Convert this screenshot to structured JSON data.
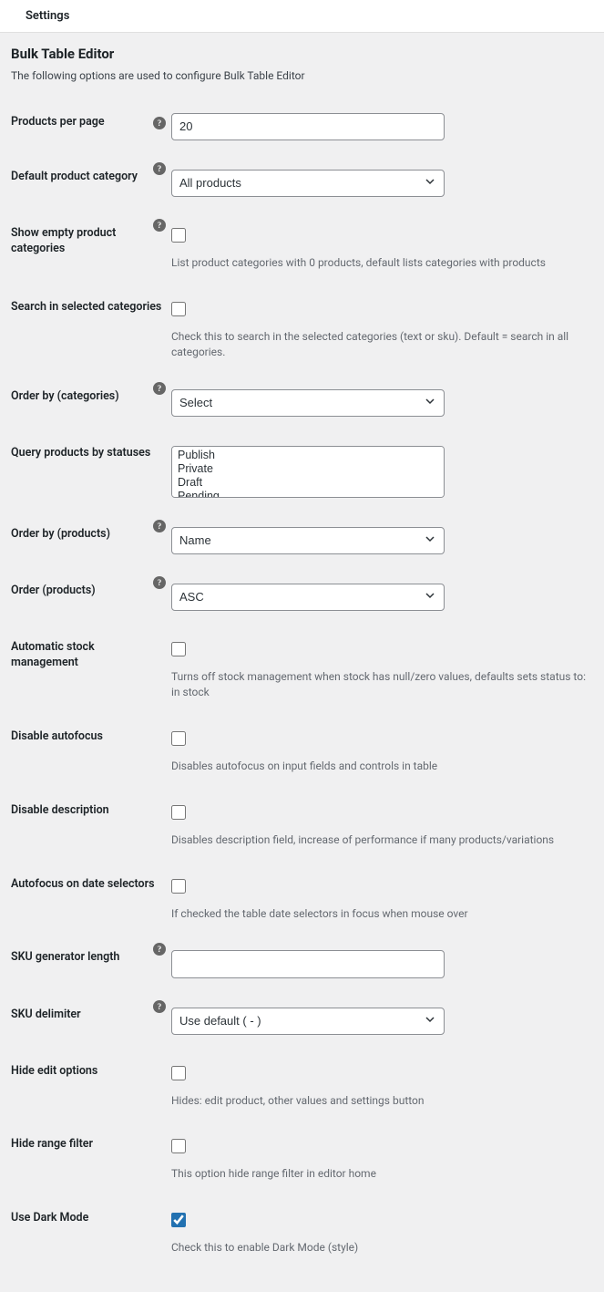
{
  "topbar": {
    "title": "Settings"
  },
  "page": {
    "heading": "Bulk Table Editor",
    "sub": "The following options are used to configure Bulk Table Editor"
  },
  "fields": {
    "products_per_page": {
      "label": "Products per page",
      "value": "20"
    },
    "default_category": {
      "label": "Default product category",
      "value": "All products"
    },
    "show_empty_cats": {
      "label": "Show empty product categories",
      "desc": "List product categories with 0 products, default lists categories with products"
    },
    "search_selected": {
      "label": "Search in selected categories",
      "desc": "Check this to search in the selected categories (text or sku). Default = search in all categories."
    },
    "order_by_cats": {
      "label": "Order by (categories)",
      "value": "Select"
    },
    "query_statuses": {
      "label": "Query products by statuses",
      "options": [
        "Publish",
        "Private",
        "Draft",
        "Pending"
      ]
    },
    "order_by_products": {
      "label": "Order by (products)",
      "value": "Name"
    },
    "order_products": {
      "label": "Order (products)",
      "value": "ASC"
    },
    "auto_stock": {
      "label": "Automatic stock management",
      "desc": "Turns off stock management when stock has null/zero values, defaults sets status to: in stock"
    },
    "disable_autofocus": {
      "label": "Disable autofocus",
      "desc": "Disables autofocus on input fields and controls in table"
    },
    "disable_description": {
      "label": "Disable description",
      "desc": "Disables description field, increase of performance if many products/variations"
    },
    "autofocus_date": {
      "label": "Autofocus on date selectors",
      "desc": "If checked the table date selectors in focus when mouse over"
    },
    "sku_length": {
      "label": "SKU generator length",
      "value": ""
    },
    "sku_delimiter": {
      "label": "SKU delimiter",
      "value": "Use default ( - )"
    },
    "hide_edit": {
      "label": "Hide edit options",
      "desc": "Hides: edit product, other values and settings button"
    },
    "hide_range": {
      "label": "Hide range filter",
      "desc": "This option hide range filter in editor home"
    },
    "dark_mode": {
      "label": "Use Dark Mode",
      "desc": "Check this to enable Dark Mode (style)"
    }
  }
}
